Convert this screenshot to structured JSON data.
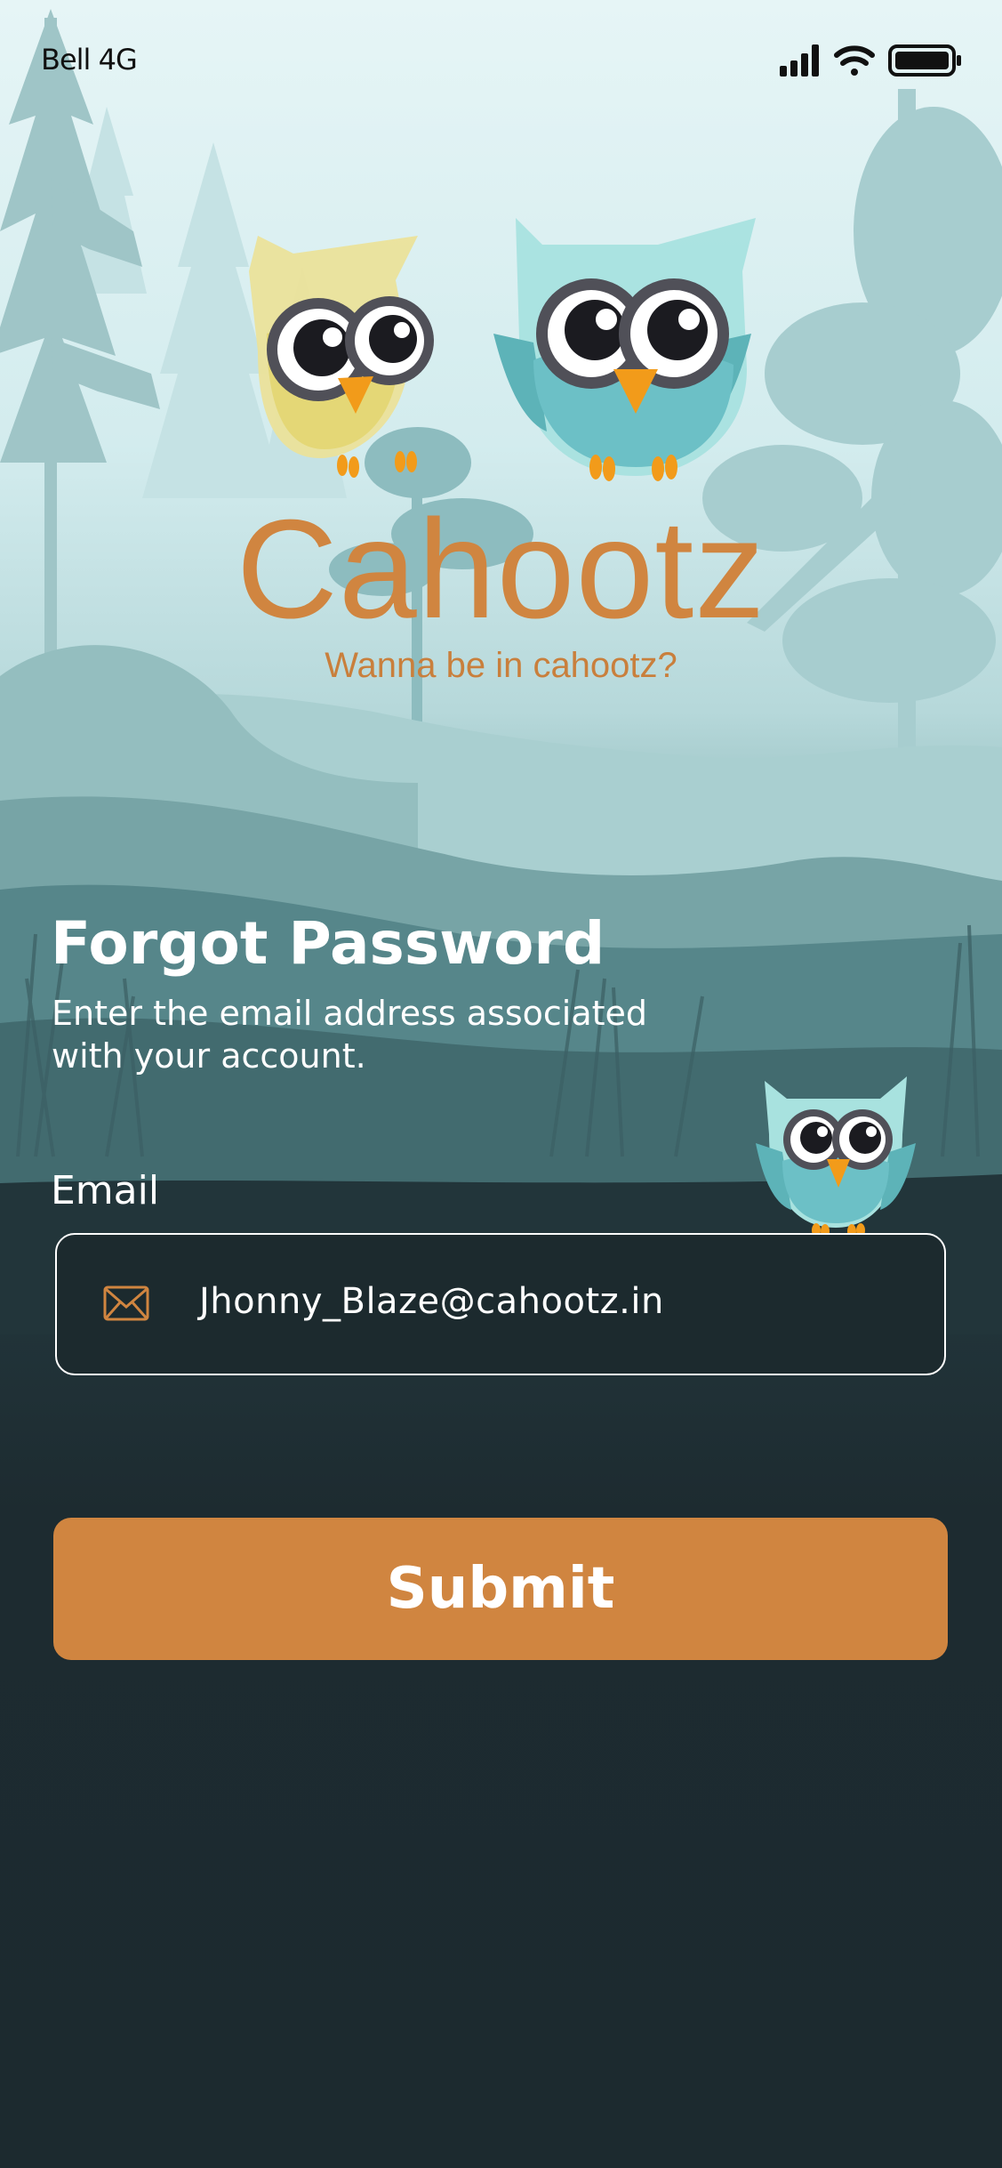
{
  "status_bar": {
    "carrier": "Bell 4G",
    "icons": [
      "cellular-signal-icon",
      "wifi-icon",
      "battery-icon"
    ]
  },
  "brand": {
    "logo_text": "Cahootz",
    "tagline": "Wanna be in cahootz?",
    "accent_color": "#d08540"
  },
  "form": {
    "title": "Forgot Password",
    "subtitle": "Enter the email address associated with your account.",
    "email_label": "Email",
    "email_value": "Jhonny_Blaze@cahootz.in",
    "email_icon": "mail-icon",
    "submit_label": "Submit"
  }
}
